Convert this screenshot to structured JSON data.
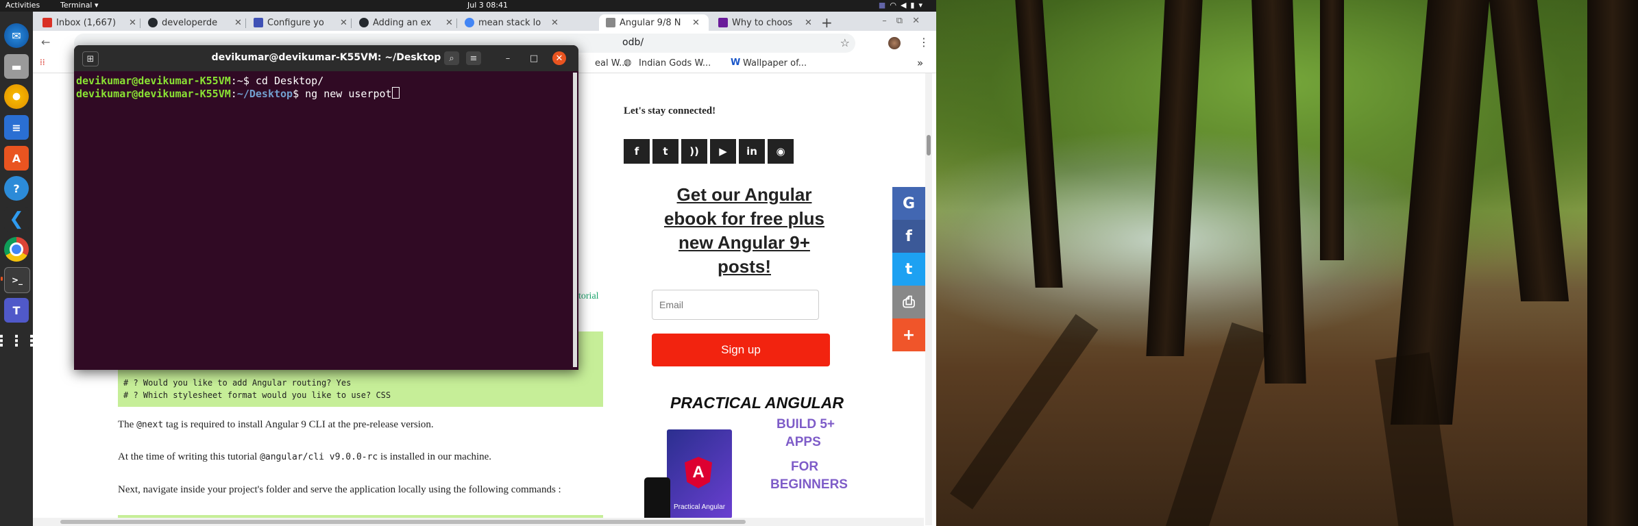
{
  "topbar": {
    "activities": "Activities",
    "app_menu": "Terminal ▾",
    "clock": "Jul 3  08:41"
  },
  "dock": {
    "items": [
      "thunderbird-icon",
      "files-icon",
      "rhythmbox-icon",
      "writer-icon",
      "software-icon",
      "help-icon",
      "vscode-icon",
      "chrome-icon",
      "terminal-icon",
      "teams-icon",
      "app-grid-icon"
    ]
  },
  "browser": {
    "tabs": [
      {
        "title": "Inbox (1,667)",
        "color": "#d93025"
      },
      {
        "title": "developerde",
        "color": "#24292e"
      },
      {
        "title": "Configure yo",
        "color": "#3f51b5"
      },
      {
        "title": "Adding an ex",
        "color": "#24292e"
      },
      {
        "title": "mean stack lo",
        "color": "#4285f4"
      },
      {
        "title": "Angular 9/8 N",
        "color": "#888888"
      },
      {
        "title": "Why to choos",
        "color": "#6a1b9a"
      }
    ],
    "new_tab": "+",
    "url_suffix": "odb/",
    "bookmarks": [
      "eal W...",
      "Indian Gods W...",
      "Wallpaper of..."
    ],
    "bookmarks_more": "»"
  },
  "page": {
    "stay_connected": "Let's stay connected!",
    "social": [
      "f",
      "t",
      "rss",
      "yt",
      "in",
      "gh"
    ],
    "ebook_heading_line1": "Get our Angular",
    "ebook_heading_line2": "ebook for free plus",
    "ebook_heading_line3": "new Angular 9+",
    "ebook_heading_line4": "posts!",
    "email_placeholder": "Email",
    "signup_label": "Sign up",
    "promo_title": "PRACTICAL ANGULAR",
    "promo_line1": "BUILD 5+",
    "promo_line2": "APPS",
    "promo_line3": "FOR",
    "promo_line4": "BEGINNERS",
    "book_label": "Practical Angular",
    "tutorial_link": "torial",
    "code_line1": "# ? Would you like to add Angular routing? Yes",
    "code_line2": "# ? Which stylesheet format would you like to use? CSS",
    "para1_a": "The ",
    "para1_code": "@next",
    "para1_b": " tag is required to install Angular 9 CLI at the pre-release version.",
    "para2_a": "At the time of writing this tutorial ",
    "para2_code": "@angular/cli v9.0.0-rc",
    "para2_b": " is installed in our machine.",
    "para3": "Next, navigate inside your project's folder and serve the application locally using the following commands :"
  },
  "share": [
    {
      "name": "google",
      "color": "#4267b2",
      "glyph": "G"
    },
    {
      "name": "facebook",
      "color": "#3b5998",
      "glyph": "f"
    },
    {
      "name": "twitter",
      "color": "#1da1f2",
      "glyph": "t"
    },
    {
      "name": "print",
      "color": "#888888",
      "glyph": "⎙"
    },
    {
      "name": "more",
      "color": "#f0552a",
      "glyph": "+"
    }
  ],
  "terminal": {
    "title": "devikumar@devikumar-K55VM: ~/Desktop",
    "line1_user": "devikumar@devikumar-K55VM",
    "line1_sep": ":~$ ",
    "line1_cmd": "cd Desktop/",
    "line2_user": "devikumar@devikumar-K55VM",
    "line2_colon": ":",
    "line2_path": "~/Desktop",
    "line2_dollar": "$ ",
    "line2_cmd": "ng new userpot"
  }
}
